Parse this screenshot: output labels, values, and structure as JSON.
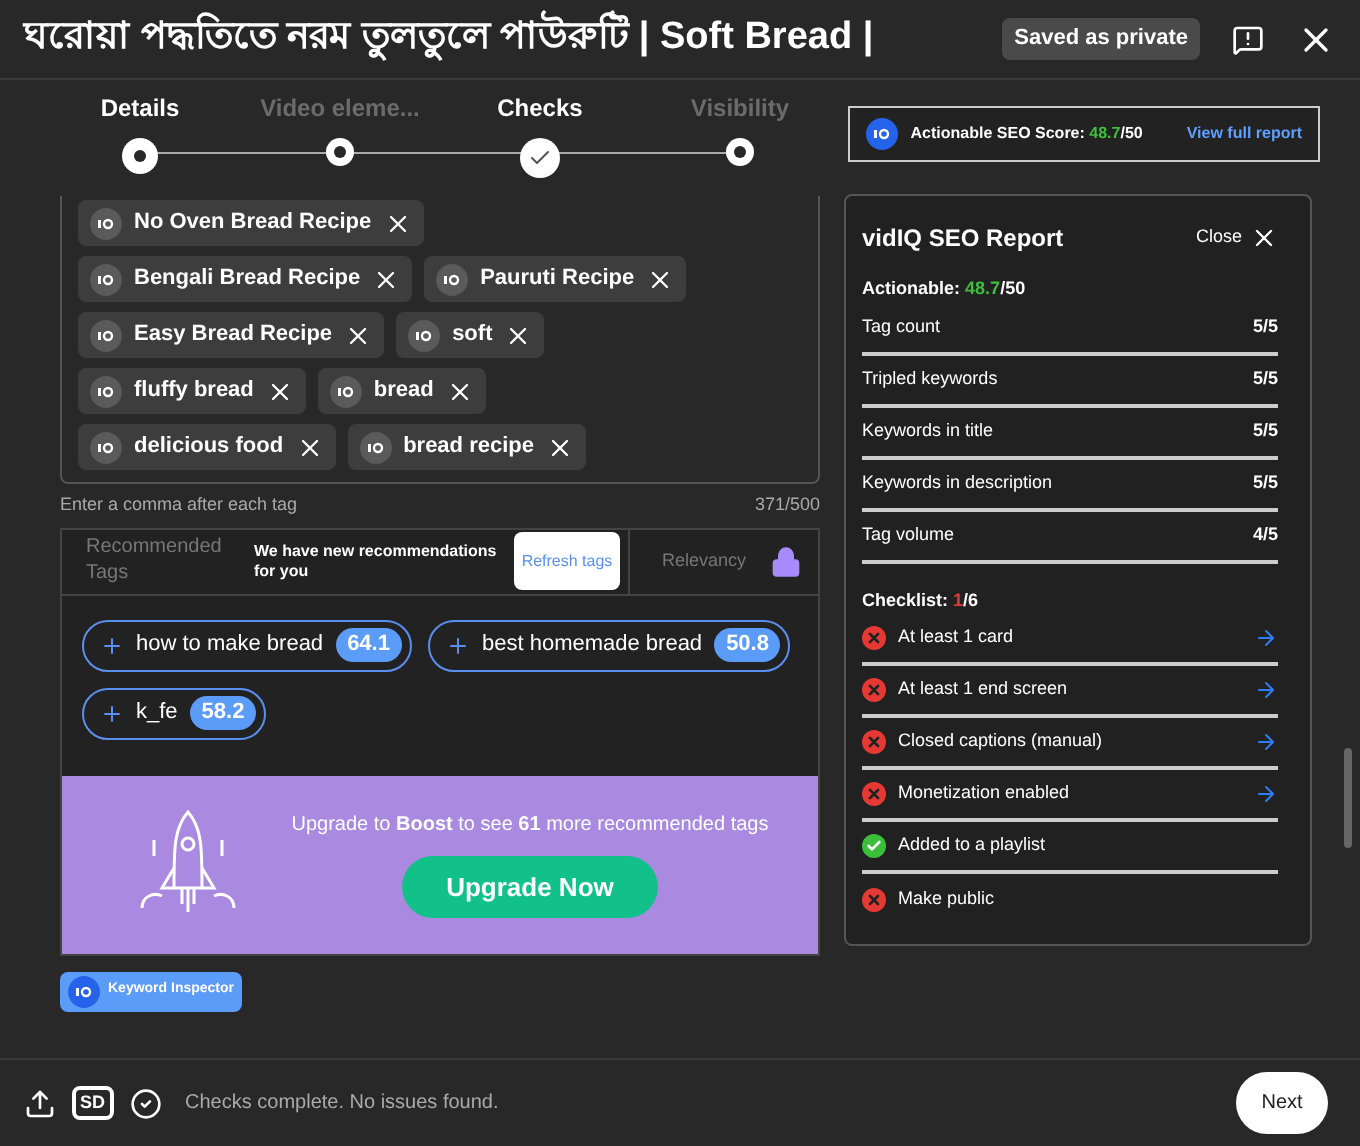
{
  "header": {
    "title": "ঘরোয়া পদ্ধতিতে নরম তুলতুলে পাউরুটি | Soft Bread |",
    "badge": "Saved as private"
  },
  "steps": [
    {
      "label": "Details",
      "active": true,
      "done": false
    },
    {
      "label": "Video eleme...",
      "active": false,
      "done": false
    },
    {
      "label": "Checks",
      "active": true,
      "done": true
    },
    {
      "label": "Visibility",
      "active": false,
      "done": false
    }
  ],
  "seo_score": {
    "label": "Actionable SEO Score:",
    "score": "48.7",
    "total": "/50",
    "link": "View full report"
  },
  "tags": [
    "No Oven Bread Recipe",
    "Bengali Bread Recipe",
    "Pauruti Recipe",
    "Easy Bread Recipe",
    "soft",
    "fluffy bread",
    "bread",
    "delicious food",
    "bread recipe"
  ],
  "tags_hint": "Enter a comma after each tag",
  "tags_count": "371/500",
  "recommend": {
    "tabs": [
      {
        "label": "Recommended Tags",
        "selected": false
      },
      {
        "label": "Relevancy",
        "selected": false
      }
    ],
    "notice": "We have new recommendations for you",
    "refresh": "Refresh tags",
    "items": [
      {
        "label": "how to make bread",
        "score": "64.1"
      },
      {
        "label": "best homemade bread",
        "score": "50.8"
      },
      {
        "label": "k_fe",
        "score": "58.2"
      }
    ]
  },
  "upgrade": {
    "text": "Upgrade to **Boost** to see **61** more recommended tags",
    "button": "Upgrade Now"
  },
  "keyword_inspector": "Keyword Inspector",
  "report": {
    "title": "vidIQ SEO Report",
    "close": "Close",
    "actionable_label": "Actionable:",
    "actionable_score": "48.7",
    "actionable_total": "/50",
    "metrics": [
      {
        "label": "Tag count",
        "value": "5/5"
      },
      {
        "label": "Tripled keywords",
        "value": "5/5"
      },
      {
        "label": "Keywords in title",
        "value": "5/5"
      },
      {
        "label": "Keywords in description",
        "value": "5/5"
      },
      {
        "label": "Tag volume",
        "value": "4/5"
      }
    ],
    "checklist_label": "Checklist:",
    "checklist_done": "1",
    "checklist_total": "/6",
    "checklist": [
      {
        "label": "At least 1 card",
        "passed": false,
        "link": true
      },
      {
        "label": "At least 1 end screen",
        "passed": false,
        "link": true
      },
      {
        "label": "Closed captions (manual)",
        "passed": false,
        "link": true
      },
      {
        "label": "Monetization enabled",
        "passed": false,
        "link": true
      },
      {
        "label": "Added to a playlist",
        "passed": true,
        "link": false
      },
      {
        "label": "Make public",
        "passed": false,
        "link": false
      }
    ]
  },
  "footer": {
    "sd": "SD",
    "status": "Checks complete. No issues found.",
    "next": "Next"
  }
}
